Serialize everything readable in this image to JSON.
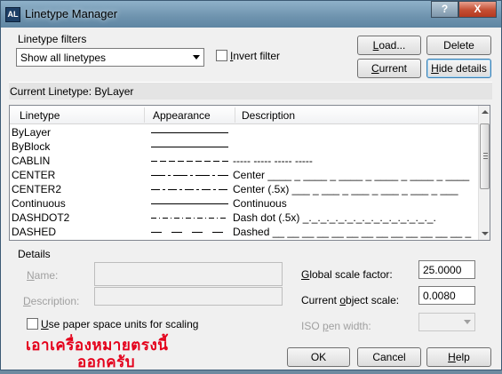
{
  "window": {
    "title": "Linetype Manager",
    "help_glyph": "?",
    "close_glyph": "X",
    "icon_glyph": "AL"
  },
  "filters": {
    "label": "Linetype filters",
    "selected": "Show all linetypes",
    "invert_label_u": "I",
    "invert_label_rest": "nvert filter"
  },
  "buttons": {
    "load_u": "L",
    "load_rest": "oad...",
    "delete": "Delete",
    "current_u": "C",
    "current_rest": "urrent",
    "hide_u": "H",
    "hide_rest": "ide details"
  },
  "current_linetype": "Current Linetype:  ByLayer",
  "list": {
    "columns": [
      "Linetype",
      "Appearance",
      "Description"
    ],
    "rows": [
      {
        "name": "ByLayer",
        "pattern": "solid",
        "desc": ""
      },
      {
        "name": "ByBlock",
        "pattern": "solid",
        "desc": ""
      },
      {
        "name": "CABLIN",
        "pattern": "dash",
        "desc": "----- ----- ----- -----"
      },
      {
        "name": "CENTER",
        "pattern": "center",
        "desc": "Center ____ _ ____ _ ____ _ ____ _ ____ _ ____"
      },
      {
        "name": "CENTER2",
        "pattern": "center2",
        "desc": "Center (.5x) ___ _ ___ _ ___ _ ___ _ ___ _ ___"
      },
      {
        "name": "Continuous",
        "pattern": "solid",
        "desc": "Continuous"
      },
      {
        "name": "DASHDOT2",
        "pattern": "dashdot",
        "desc": "Dash dot (.5x) _._._._._._._._._._._._._._._."
      },
      {
        "name": "DASHED",
        "pattern": "dashed",
        "desc": "Dashed __ __ __ __ __ __ __ __ __ __ __ __ __ _"
      }
    ]
  },
  "details": {
    "group_label": "Details",
    "name_u": "N",
    "name_rest": "ame:",
    "description_u": "D",
    "description_rest": "escription:",
    "paper_space_u": "U",
    "paper_space_rest": "se paper space units for scaling",
    "global_scale_u": "G",
    "global_scale_rest": "lobal scale factor:",
    "global_scale_value": "25.0000",
    "current_scale_pre": "Current ",
    "current_scale_u": "o",
    "current_scale_rest": "bject scale:",
    "current_scale_value": "0.0080",
    "iso_pre": "ISO ",
    "iso_u": "p",
    "iso_rest": "en width:"
  },
  "footer": {
    "ok": "OK",
    "cancel": "Cancel",
    "help_u": "H",
    "help_rest": "elp"
  },
  "annotation": {
    "line1": "เอาเครื่องหมายตรงนี้",
    "line2": "ออกครับ",
    "color": "#e4001b"
  }
}
